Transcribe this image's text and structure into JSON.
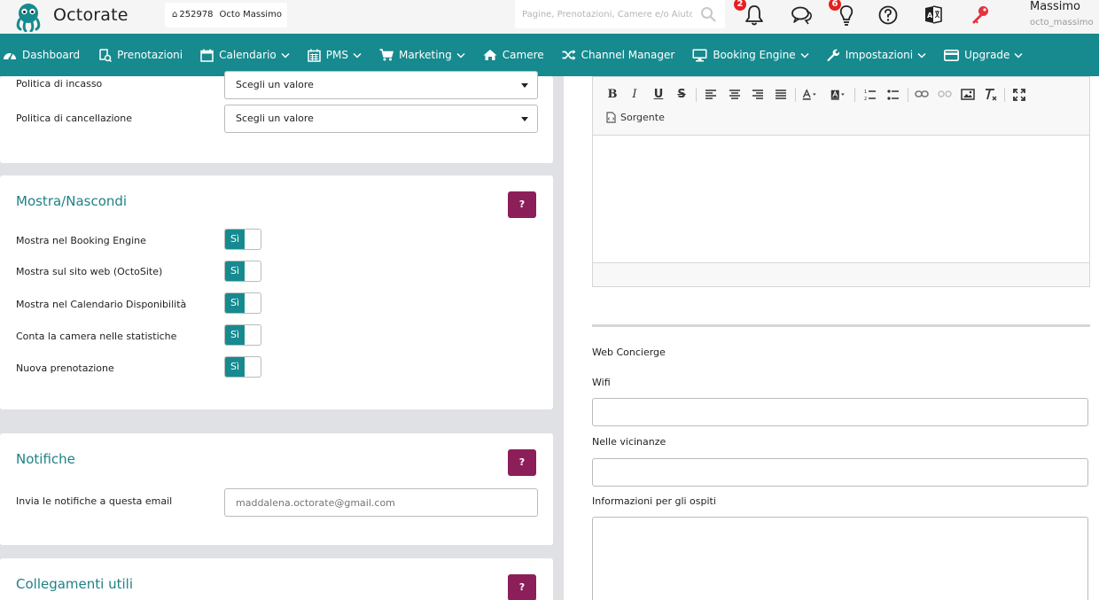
{
  "header": {
    "logo_text": "Octorate",
    "property_id": "252978",
    "property_name": "Octo Massimo",
    "search_placeholder": "Pagine, Prenotazioni, Camere e/o Aiuto",
    "notifications_count": "2",
    "tips_count": "6",
    "user_name": "Massimo",
    "user_handle": "octo_massimo",
    "icons": [
      "bell-icon",
      "chat-icon",
      "lightbulb-icon",
      "help-icon",
      "translate-icon",
      "key-icon"
    ],
    "colors": {
      "badge": "#e52020",
      "key": "#e5323e"
    }
  },
  "nav": {
    "items": [
      {
        "label": "Dashboard",
        "icon": "tachometer-icon",
        "dropdown": false
      },
      {
        "label": "Prenotazioni",
        "icon": "booking-icon",
        "dropdown": false
      },
      {
        "label": "Calendario",
        "icon": "calendar-icon",
        "dropdown": true
      },
      {
        "label": "PMS",
        "icon": "calendar-grid-icon",
        "dropdown": true
      },
      {
        "label": "Marketing",
        "icon": "cart-icon",
        "dropdown": true
      },
      {
        "label": "Camere",
        "icon": "home-icon",
        "dropdown": false
      },
      {
        "label": "Channel Manager",
        "icon": "shuffle-icon",
        "dropdown": false
      },
      {
        "label": "Booking Engine",
        "icon": "monitor-icon",
        "dropdown": true
      },
      {
        "label": "Impostazioni",
        "icon": "wrench-icon",
        "dropdown": true
      },
      {
        "label": "Upgrade",
        "icon": "credit-card-icon",
        "dropdown": true
      }
    ],
    "color": "#168a8e"
  },
  "policies": {
    "incasso_label": "Politica di incasso",
    "incasso_value": "Scegli un valore",
    "cancellazione_label": "Politica di cancellazione",
    "cancellazione_value": "Scegli un valore"
  },
  "visibility": {
    "title": "Mostra/Nascondi",
    "help": "?",
    "toggles": [
      {
        "label": "Mostra nel Booking Engine",
        "value": "Sì"
      },
      {
        "label": "Mostra sul sito web (OctoSite)",
        "value": "Sì"
      },
      {
        "label": "Mostra nel Calendario Disponibilità",
        "value": "Sì"
      },
      {
        "label": "Conta la camera nelle statistiche",
        "value": "Sì"
      },
      {
        "label": "Nuova prenotazione",
        "value": "Sì"
      }
    ]
  },
  "notifications": {
    "title": "Notifiche",
    "help": "?",
    "email_label": "Invia le notifiche a questa email",
    "email_placeholder": "maddalena.octorate@gmail.com"
  },
  "links": {
    "title": "Collegamenti utili",
    "help": "?"
  },
  "editor": {
    "source_label": "Sorgente",
    "tools": [
      "bold-icon",
      "italic-icon",
      "underline-icon",
      "strikethrough-icon",
      "align-left-icon",
      "align-center-icon",
      "align-right-icon",
      "justify-icon",
      "text-color-icon",
      "bg-color-icon",
      "numbered-list-icon",
      "bullet-list-icon",
      "link-icon",
      "unlink-icon",
      "image-icon",
      "clear-format-icon",
      "maximize-icon"
    ]
  },
  "concierge": {
    "title": "Web Concierge",
    "wifi_label": "Wifi",
    "nearby_label": "Nelle vicinanze",
    "guest_info_label": "Informazioni per gli ospiti"
  }
}
